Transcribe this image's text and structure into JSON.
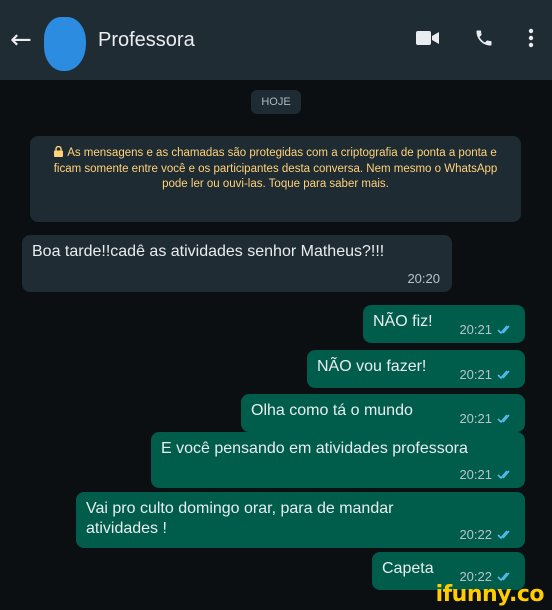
{
  "header": {
    "back_icon": "arrow-left-icon",
    "contact_name": "Professora",
    "icons": [
      "video-call-icon",
      "phone-icon",
      "more-vert-icon"
    ]
  },
  "date_chip": "HOJE",
  "encryption_notice": "As mensagens e as chamadas são protegidas com a criptografia de ponta a ponta e ficam somente entre você e os participantes desta conversa. Nem mesmo o WhatsApp pode ler ou ouvi-las. Toque para saber mais.",
  "messages": [
    {
      "direction": "in",
      "text": "Boa tarde!!cadê  as atividades senhor Matheus?!!!",
      "time": "20:20"
    },
    {
      "direction": "out",
      "text": "NÃO fiz!",
      "time": "20:21",
      "status": "read"
    },
    {
      "direction": "out",
      "text": "NÃO vou fazer!",
      "time": "20:21",
      "status": "read"
    },
    {
      "direction": "out",
      "text": "Olha como tá o mundo",
      "time": "20:21",
      "status": "read"
    },
    {
      "direction": "out",
      "text": "E você pensando em atividades professora",
      "time": "20:21",
      "status": "read"
    },
    {
      "direction": "out",
      "text": "Vai pro culto domingo orar, para de mandar atividades !",
      "time": "20:22",
      "status": "read"
    },
    {
      "direction": "out",
      "text": "Capeta",
      "time": "20:22",
      "status": "read"
    }
  ],
  "watermark": "ifunny.co",
  "colors": {
    "header": "#1f2c34",
    "incoming": "#1f2c34",
    "outgoing": "#005c4b",
    "read_ticks": "#53bdeb",
    "notice_text": "#ffd279"
  }
}
